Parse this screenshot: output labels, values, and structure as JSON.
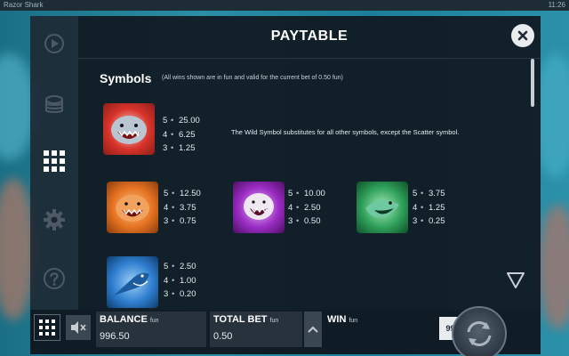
{
  "window": {
    "title": "Razor Shark",
    "clock": "11:26"
  },
  "panel": {
    "title": "PAYTABLE"
  },
  "symbols_section": {
    "title": "Symbols",
    "note": "(All wins shown are in fun and valid for the current bet of 0.50 fun)",
    "wild_description": "The Wild Symbol substitutes for all other symbols, except the Scatter symbol."
  },
  "symbols": [
    {
      "icon": "wild-shark-symbol-icon",
      "color": "#d8342a",
      "pays": [
        {
          "count": "5",
          "value": "25.00"
        },
        {
          "count": "4",
          "value": "6.25"
        },
        {
          "count": "3",
          "value": "1.25"
        }
      ]
    },
    {
      "icon": "orange-shark-symbol-icon",
      "color": "#e67322",
      "pays": [
        {
          "count": "5",
          "value": "12.50"
        },
        {
          "count": "4",
          "value": "3.75"
        },
        {
          "count": "3",
          "value": "0.75"
        }
      ]
    },
    {
      "icon": "purple-shark-symbol-icon",
      "color": "#9b2cc4",
      "pays": [
        {
          "count": "5",
          "value": "10.00"
        },
        {
          "count": "4",
          "value": "2.50"
        },
        {
          "count": "3",
          "value": "0.50"
        }
      ]
    },
    {
      "icon": "green-shark-symbol-icon",
      "color": "#2fa15a",
      "pays": [
        {
          "count": "5",
          "value": "3.75"
        },
        {
          "count": "4",
          "value": "1.25"
        },
        {
          "count": "3",
          "value": "0.25"
        }
      ]
    },
    {
      "icon": "blue-swordfish-symbol-icon",
      "color": "#2f7fd0",
      "pays": [
        {
          "count": "5",
          "value": "2.50"
        },
        {
          "count": "4",
          "value": "1.00"
        },
        {
          "count": "3",
          "value": "0.20"
        }
      ]
    }
  ],
  "bottom_bar": {
    "balance": {
      "label": "BALANCE",
      "unit": "fun",
      "value": "996.50"
    },
    "total_bet": {
      "label": "TOTAL BET",
      "unit": "fun",
      "value": "0.50"
    },
    "win": {
      "label": "WIN",
      "unit": "fun"
    },
    "autoplay_label": "994"
  },
  "colors": {
    "panel_bg": "#10181f",
    "accent": "#e8ecef"
  }
}
